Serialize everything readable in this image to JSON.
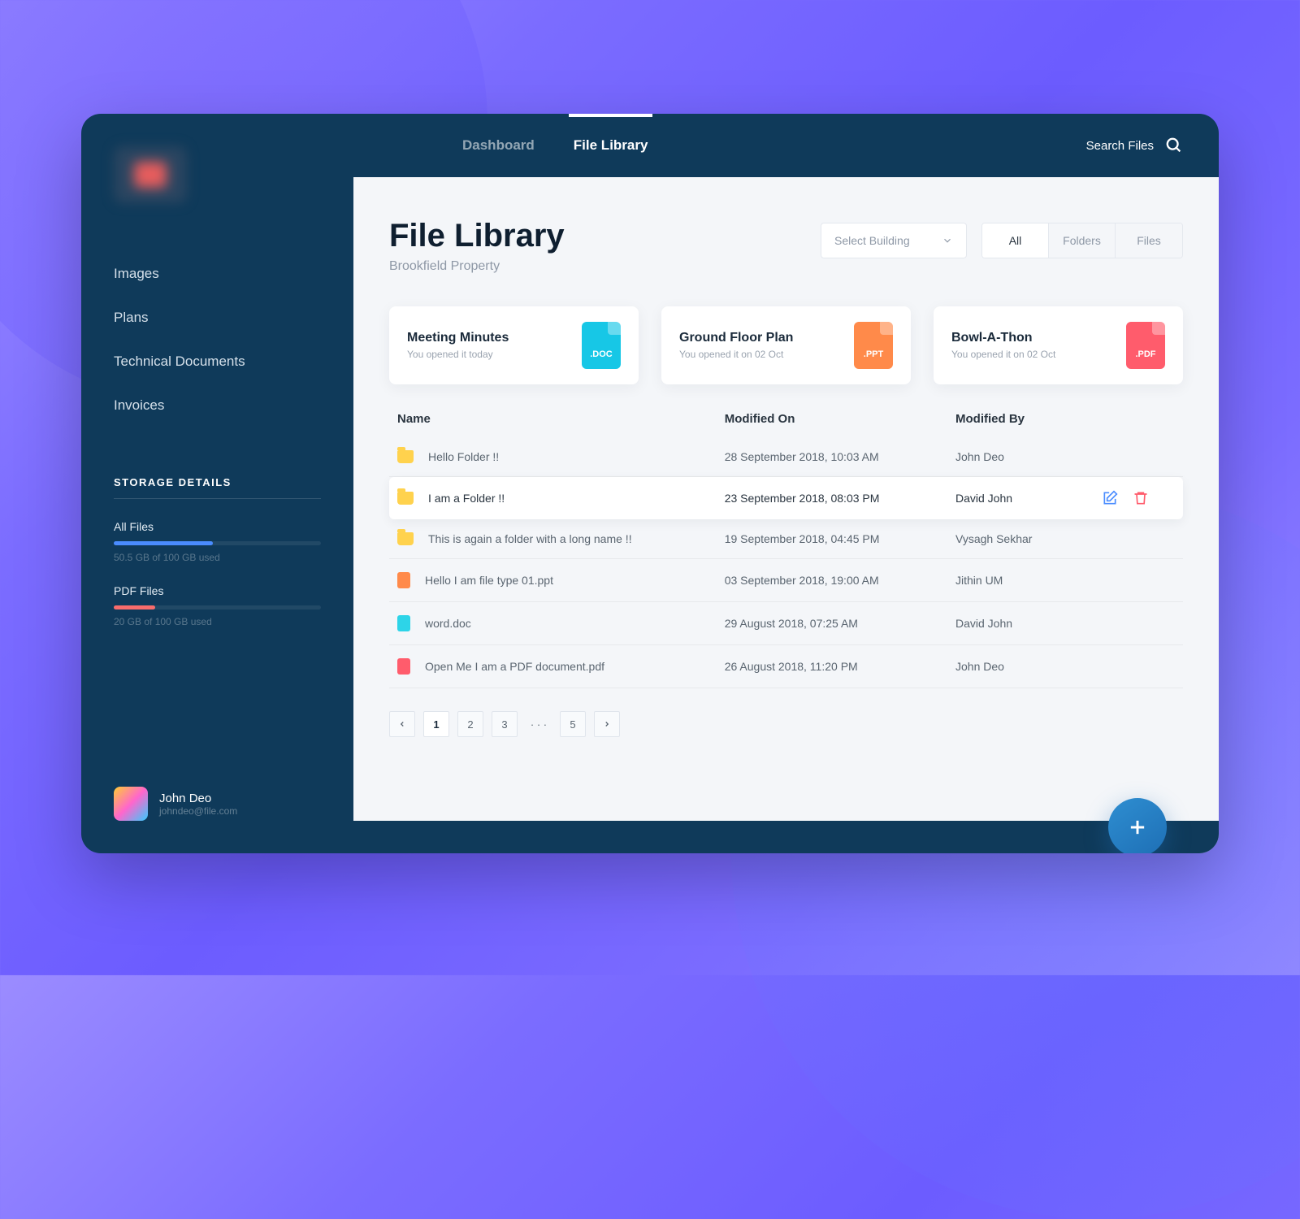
{
  "nav": {
    "items": [
      "Images",
      "Plans",
      "Technical Documents",
      "Invoices"
    ]
  },
  "storage": {
    "title": "STORAGE DETAILS",
    "all": {
      "label": "All Files",
      "sub": "50.5 GB of 100 GB used"
    },
    "pdf": {
      "label": "PDF Files",
      "sub": "20 GB of 100 GB used"
    }
  },
  "user": {
    "name": "John Deo",
    "email": "johndeo@file.com"
  },
  "tabs": {
    "dashboard": "Dashboard",
    "library": "File Library"
  },
  "search": {
    "label": "Search Files"
  },
  "page": {
    "title": "File Library",
    "subtitle": "Brookfield Property",
    "select": "Select Building",
    "seg": {
      "all": "All",
      "folders": "Folders",
      "files": "Files"
    }
  },
  "cards": [
    {
      "title": "Meeting Minutes",
      "sub": "You opened it today",
      "ext": ".DOC"
    },
    {
      "title": "Ground Floor Plan",
      "sub": "You opened it on 02 Oct",
      "ext": ".PPT"
    },
    {
      "title": "Bowl-A-Thon",
      "sub": "You opened it on 02 Oct",
      "ext": ".PDF"
    }
  ],
  "columns": {
    "name": "Name",
    "modified": "Modified On",
    "by": "Modified By"
  },
  "rows": [
    {
      "name": "Hello Folder !!",
      "modified": "28 September 2018, 10:03 AM",
      "by": "John Deo"
    },
    {
      "name": "I am a Folder !!",
      "modified": "23 September 2018, 08:03 PM",
      "by": "David John"
    },
    {
      "name": "This is again a folder with a long name !!",
      "modified": "19 September 2018, 04:45 PM",
      "by": "Vysagh Sekhar"
    },
    {
      "name": "Hello I am file type 01.ppt",
      "modified": "03 September 2018, 19:00 AM",
      "by": "Jithin UM"
    },
    {
      "name": "word.doc",
      "modified": "29 August 2018, 07:25 AM",
      "by": "David John"
    },
    {
      "name": "Open Me I am a PDF document.pdf",
      "modified": "26 August 2018, 11:20 PM",
      "by": "John Deo"
    }
  ],
  "pager": {
    "p1": "1",
    "p2": "2",
    "p3": "3",
    "dots": "· · ·",
    "p5": "5"
  }
}
